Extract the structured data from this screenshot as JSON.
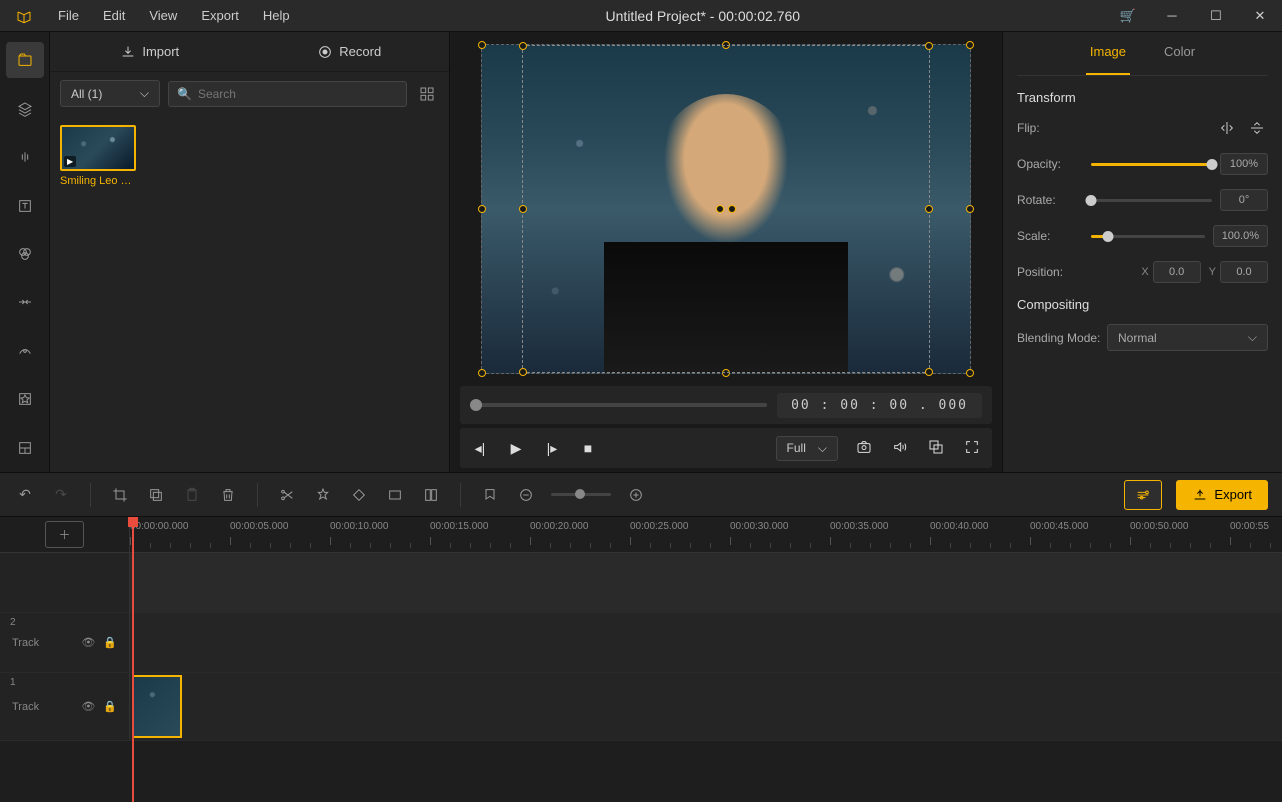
{
  "titlebar": {
    "title": "Untitled Project* - 00:00:02.760",
    "menu": [
      "File",
      "Edit",
      "View",
      "Export",
      "Help"
    ]
  },
  "media": {
    "import_label": "Import",
    "record_label": "Record",
    "filter_label": "All (1)",
    "search_placeholder": "Search",
    "clips": [
      {
        "label": "Smiling Leo …"
      }
    ]
  },
  "preview": {
    "timecode": "00 : 00 : 00 . 000",
    "fit_label": "Full"
  },
  "props": {
    "tabs": {
      "image": "Image",
      "color": "Color"
    },
    "transform_title": "Transform",
    "flip_label": "Flip:",
    "opacity_label": "Opacity:",
    "opacity_value": "100%",
    "opacity_pct": 100,
    "rotate_label": "Rotate:",
    "rotate_value": "0°",
    "rotate_pct": 0,
    "scale_label": "Scale:",
    "scale_value": "100.0%",
    "scale_pct": 15,
    "position_label": "Position:",
    "position_x": "0.0",
    "position_y": "0.0",
    "compositing_title": "Compositing",
    "blend_label": "Blending Mode:",
    "blend_value": "Normal"
  },
  "toolbar": {
    "export_label": "Export"
  },
  "timeline": {
    "ticks": [
      "00:00:00.000",
      "00:00:05.000",
      "00:00:10.000",
      "00:00:15.000",
      "00:00:20.000",
      "00:00:25.000",
      "00:00:30.000",
      "00:00:35.000",
      "00:00:40.000",
      "00:00:45.000",
      "00:00:50.000",
      "00:00:55"
    ],
    "track2": {
      "num": "2",
      "label": "Track"
    },
    "track1": {
      "num": "1",
      "label": "Track"
    }
  }
}
